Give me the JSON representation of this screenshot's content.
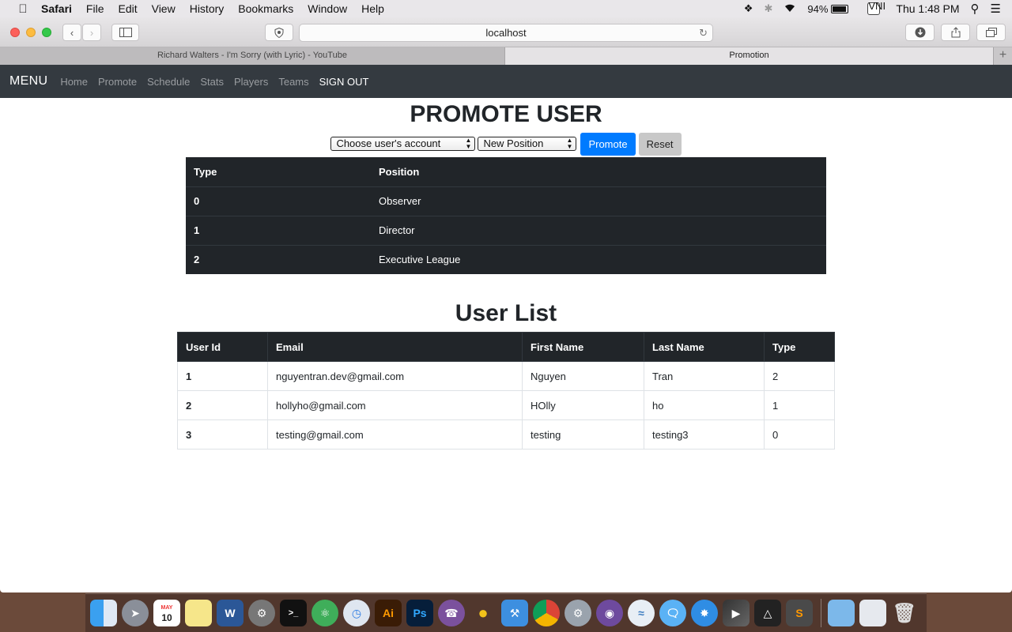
{
  "menubar": {
    "app": "Safari",
    "items": [
      "File",
      "Edit",
      "View",
      "History",
      "Bookmarks",
      "Window",
      "Help"
    ],
    "battery": "94%",
    "input_method": "VNI",
    "clock": "Thu 1:48 PM"
  },
  "browser": {
    "address": "localhost",
    "tabs": [
      {
        "title": "Richard Walters - I'm Sorry (with Lyric) - YouTube",
        "active": false
      },
      {
        "title": "Promotion",
        "active": true
      }
    ],
    "new_tab": "+"
  },
  "navbar": {
    "brand": "MENU",
    "links": [
      "Home",
      "Promote",
      "Schedule",
      "Stats",
      "Players",
      "Teams"
    ],
    "sign_out": "SIGN OUT"
  },
  "promote": {
    "title": "PROMOTE USER",
    "user_select": "Choose user's account",
    "position_select": "New Position",
    "promote_button": "Promote",
    "reset_button": "Reset"
  },
  "types_table": {
    "headers": [
      "Type",
      "Position"
    ],
    "rows": [
      [
        "0",
        "Observer"
      ],
      [
        "1",
        "Director"
      ],
      [
        "2",
        "Executive League"
      ]
    ]
  },
  "users": {
    "title": "User List",
    "headers": [
      "User Id",
      "Email",
      "First Name",
      "Last Name",
      "Type"
    ],
    "rows": [
      [
        "1",
        "nguyentran.dev@gmail.com",
        "Nguyen",
        "Tran",
        "2"
      ],
      [
        "2",
        "hollyho@gmail.com",
        "HOlly",
        "ho",
        "1"
      ],
      [
        "3",
        "testing@gmail.com",
        "testing",
        "testing3",
        "0"
      ]
    ]
  },
  "dock": {
    "calendar_month": "MAY",
    "calendar_day": "10",
    "apps": [
      "finder-icon",
      "launchpad-icon",
      "calendar-icon",
      "notes-icon",
      "word-icon",
      "system-prefs-icon",
      "terminal-icon",
      "atom-icon",
      "time-icon",
      "illustrator-icon",
      "photoshop-icon",
      "viber-icon",
      "cyberduck-icon",
      "xcode-icon",
      "chrome-icon",
      "settings-icon",
      "github-icon",
      "mustache-icon",
      "messages-icon",
      "safari-icon",
      "final-cut-icon",
      "unity-icon",
      "sublime-icon",
      "folder-icon",
      "preview-icon",
      "trash-icon"
    ],
    "labels": {
      "word": "W",
      "illustrator": "Ai",
      "photoshop": "Ps",
      "sublime": "S",
      "terminal": ">_"
    }
  }
}
